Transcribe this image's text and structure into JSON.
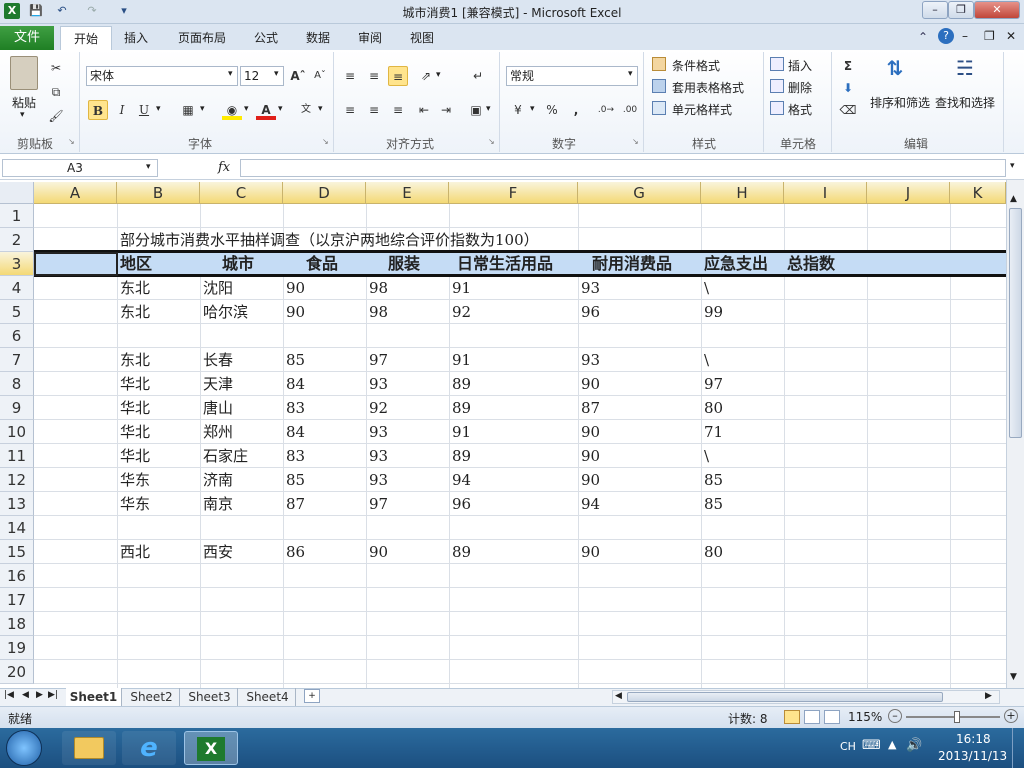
{
  "window": {
    "title": "城市消费1  [兼容模式] - Microsoft Excel"
  },
  "ribbon": {
    "file_tab": "文件",
    "tabs": [
      "开始",
      "插入",
      "页面布局",
      "公式",
      "数据",
      "审阅",
      "视图"
    ],
    "active_tab": "开始",
    "font_name": "宋体",
    "font_size": "12",
    "number_format": "常规",
    "paste_label": "粘贴",
    "groups": [
      "剪贴板",
      "字体",
      "对齐方式",
      "数字",
      "样式",
      "单元格",
      "编辑"
    ],
    "styles": {
      "conditional": "条件格式",
      "table": "套用表格格式",
      "cell": "单元格样式"
    },
    "cells": {
      "insert": "插入",
      "delete": "删除",
      "format": "格式"
    },
    "editing": {
      "sort": "排序和筛选",
      "find": "查找和选择"
    }
  },
  "formula_bar": {
    "name_box": "A3",
    "fx": "fx",
    "value": ""
  },
  "columns": [
    "A",
    "B",
    "C",
    "D",
    "E",
    "F",
    "G",
    "H",
    "I",
    "J",
    "K"
  ],
  "rows": [
    "1",
    "2",
    "3",
    "4",
    "5",
    "6",
    "7",
    "8",
    "9",
    "10",
    "11",
    "12",
    "13",
    "14",
    "15",
    "16",
    "17",
    "18",
    "19",
    "20"
  ],
  "sheet": {
    "title": "部分城市消费水平抽样调查（以京沪两地综合评价指数为100）",
    "headers": [
      "地区",
      "城市",
      "食品",
      "服装",
      "日常生活用品",
      "耐用消费品",
      "应急支出",
      "总指数"
    ],
    "data": [
      {
        "row": "4",
        "cells": [
          "东北",
          "沈阳",
          "90",
          "98",
          "91",
          "93",
          "\\"
        ]
      },
      {
        "row": "5",
        "cells": [
          "东北",
          "哈尔滨",
          "90",
          "98",
          "92",
          "96",
          "99"
        ]
      },
      {
        "row": "7",
        "cells": [
          "东北",
          "长春",
          "85",
          "97",
          "91",
          "93",
          "\\"
        ]
      },
      {
        "row": "8",
        "cells": [
          "华北",
          "天津",
          "84",
          "93",
          "89",
          "90",
          "97"
        ]
      },
      {
        "row": "9",
        "cells": [
          "华北",
          "唐山",
          "83",
          "92",
          "89",
          "87",
          "80"
        ]
      },
      {
        "row": "10",
        "cells": [
          "华北",
          "郑州",
          "84",
          "93",
          "91",
          "90",
          "71"
        ]
      },
      {
        "row": "11",
        "cells": [
          "华北",
          "石家庄",
          "83",
          "93",
          "89",
          "90",
          "\\"
        ]
      },
      {
        "row": "12",
        "cells": [
          "华东",
          "济南",
          "85",
          "93",
          "94",
          "90",
          "85"
        ]
      },
      {
        "row": "13",
        "cells": [
          "华东",
          "南京",
          "87",
          "97",
          "96",
          "94",
          "85"
        ]
      },
      {
        "row": "15",
        "cells": [
          "西北",
          "西安",
          "86",
          "90",
          "89",
          "90",
          "80"
        ]
      }
    ]
  },
  "sheet_tabs": [
    "Sheet1",
    "Sheet2",
    "Sheet3",
    "Sheet4"
  ],
  "active_sheet": "Sheet1",
  "status": {
    "ready": "就绪",
    "count": "计数: 8",
    "zoom": "115%"
  },
  "taskbar": {
    "ime": "CH",
    "time": "16:18",
    "date": "2013/11/13"
  }
}
